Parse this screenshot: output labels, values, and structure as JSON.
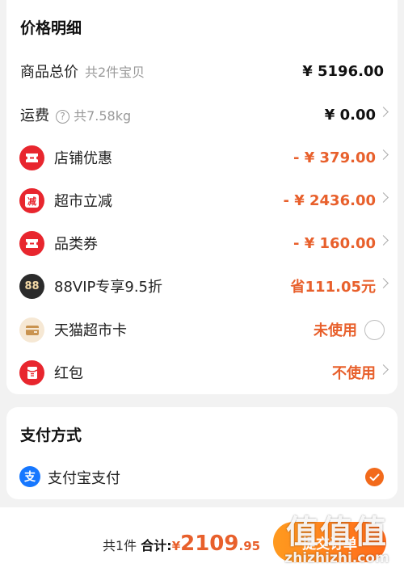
{
  "price_section": {
    "title": "价格明细",
    "items": [
      {
        "label": "商品总价",
        "sub": "共2件宝贝",
        "value": "¥ 5196.00",
        "icon": "none"
      },
      {
        "label": "运费",
        "sub": "共7.58kg",
        "value": "¥ 0.00",
        "icon": "question-icon"
      },
      {
        "label": "店铺优惠",
        "value": "- ¥ 379.00",
        "icon": "coupon-ticket-icon"
      },
      {
        "label": "超市立减",
        "value": "- ¥ 2436.00",
        "icon": "instant-discount-icon",
        "icon_text": "减"
      },
      {
        "label": "品类券",
        "value": "- ¥ 160.00",
        "icon": "coupon-ticket-icon"
      },
      {
        "label": "88VIP专享9.5折",
        "value": "省111.05元",
        "icon": "88vip-badge-icon",
        "icon_text": "88"
      },
      {
        "label": "天猫超市卡",
        "value": "未使用",
        "icon": "wallet-card-icon"
      },
      {
        "label": "红包",
        "value": "不使用",
        "icon": "red-packet-icon"
      }
    ]
  },
  "payment_section": {
    "title": "支付方式",
    "method": {
      "label": "支付宝支付",
      "icon": "alipay-icon",
      "icon_text": "支",
      "selected": true
    }
  },
  "bottom_bar": {
    "count_text": "共1件",
    "total_label": "合计:",
    "currency": "¥",
    "total_int": "2109",
    "total_dec": ".95",
    "submit_label": "提交订单"
  },
  "watermark": {
    "mark": "值值值",
    "site": "zhizhizhi.com"
  },
  "colors": {
    "accent": "#e8602c",
    "icon_red": "#e8262e",
    "check_orange": "#f26a1b",
    "alipay_blue": "#1677ff"
  }
}
